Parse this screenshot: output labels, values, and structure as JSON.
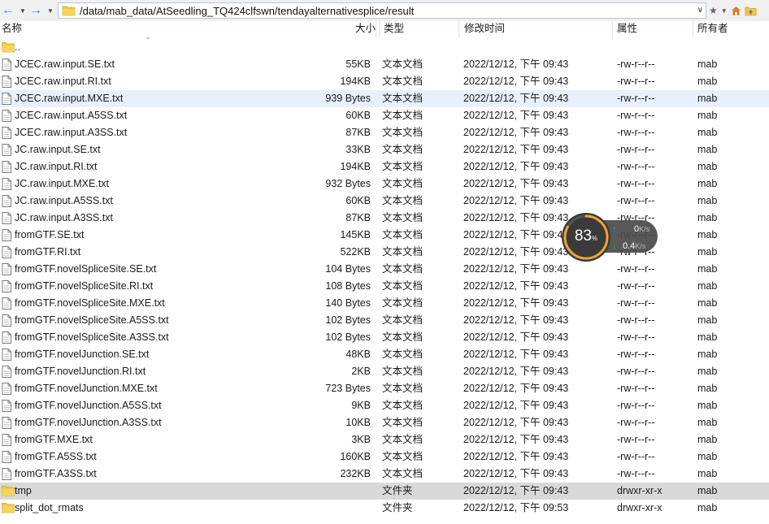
{
  "toolbar": {
    "path": "/data/mab_data/AtSeedling_TQ424clfswn/tendayalternativesplice/result",
    "back_icon": "back-arrow-icon",
    "forward_icon": "forward-arrow-icon",
    "star_icon": "star-icon",
    "home_icon": "home-icon",
    "parent_icon": "folder-up-icon"
  },
  "columns": {
    "name": "名称",
    "size": "大小",
    "type": "类型",
    "mtime": "修改时间",
    "perm": "属性",
    "owner": "所有者"
  },
  "rows": [
    {
      "name": "..",
      "size": "",
      "type": "",
      "mtime": "",
      "perm": "",
      "owner": "",
      "kind": "folder"
    },
    {
      "name": "JCEC.raw.input.SE.txt",
      "size": "55KB",
      "type": "文本文档",
      "mtime": "2022/12/12, 下午 09:43",
      "perm": "-rw-r--r--",
      "owner": "mab",
      "kind": "file"
    },
    {
      "name": "JCEC.raw.input.RI.txt",
      "size": "194KB",
      "type": "文本文档",
      "mtime": "2022/12/12, 下午 09:43",
      "perm": "-rw-r--r--",
      "owner": "mab",
      "kind": "file"
    },
    {
      "name": "JCEC.raw.input.MXE.txt",
      "size": "939 Bytes",
      "type": "文本文档",
      "mtime": "2022/12/12, 下午 09:43",
      "perm": "-rw-r--r--",
      "owner": "mab",
      "kind": "file"
    },
    {
      "name": "JCEC.raw.input.A5SS.txt",
      "size": "60KB",
      "type": "文本文档",
      "mtime": "2022/12/12, 下午 09:43",
      "perm": "-rw-r--r--",
      "owner": "mab",
      "kind": "file"
    },
    {
      "name": "JCEC.raw.input.A3SS.txt",
      "size": "87KB",
      "type": "文本文档",
      "mtime": "2022/12/12, 下午 09:43",
      "perm": "-rw-r--r--",
      "owner": "mab",
      "kind": "file"
    },
    {
      "name": "JC.raw.input.SE.txt",
      "size": "33KB",
      "type": "文本文档",
      "mtime": "2022/12/12, 下午 09:43",
      "perm": "-rw-r--r--",
      "owner": "mab",
      "kind": "file"
    },
    {
      "name": "JC.raw.input.RI.txt",
      "size": "194KB",
      "type": "文本文档",
      "mtime": "2022/12/12, 下午 09:43",
      "perm": "-rw-r--r--",
      "owner": "mab",
      "kind": "file"
    },
    {
      "name": "JC.raw.input.MXE.txt",
      "size": "932 Bytes",
      "type": "文本文档",
      "mtime": "2022/12/12, 下午 09:43",
      "perm": "-rw-r--r--",
      "owner": "mab",
      "kind": "file"
    },
    {
      "name": "JC.raw.input.A5SS.txt",
      "size": "60KB",
      "type": "文本文档",
      "mtime": "2022/12/12, 下午 09:43",
      "perm": "-rw-r--r--",
      "owner": "mab",
      "kind": "file"
    },
    {
      "name": "JC.raw.input.A3SS.txt",
      "size": "87KB",
      "type": "文本文档",
      "mtime": "2022/12/12, 下午 09:43",
      "perm": "-rw-r--r--",
      "owner": "mab",
      "kind": "file"
    },
    {
      "name": "fromGTF.SE.txt",
      "size": "145KB",
      "type": "文本文档",
      "mtime": "2022/12/12, 下午 09:43",
      "perm": "-rw-r--r--",
      "owner": "mab",
      "kind": "file"
    },
    {
      "name": "fromGTF.RI.txt",
      "size": "522KB",
      "type": "文本文档",
      "mtime": "2022/12/12, 下午 09:43",
      "perm": "-rw-r--r--",
      "owner": "mab",
      "kind": "file"
    },
    {
      "name": "fromGTF.novelSpliceSite.SE.txt",
      "size": "104 Bytes",
      "type": "文本文档",
      "mtime": "2022/12/12, 下午 09:43",
      "perm": "-rw-r--r--",
      "owner": "mab",
      "kind": "file"
    },
    {
      "name": "fromGTF.novelSpliceSite.RI.txt",
      "size": "108 Bytes",
      "type": "文本文档",
      "mtime": "2022/12/12, 下午 09:43",
      "perm": "-rw-r--r--",
      "owner": "mab",
      "kind": "file"
    },
    {
      "name": "fromGTF.novelSpliceSite.MXE.txt",
      "size": "140 Bytes",
      "type": "文本文档",
      "mtime": "2022/12/12, 下午 09:43",
      "perm": "-rw-r--r--",
      "owner": "mab",
      "kind": "file"
    },
    {
      "name": "fromGTF.novelSpliceSite.A5SS.txt",
      "size": "102 Bytes",
      "type": "文本文档",
      "mtime": "2022/12/12, 下午 09:43",
      "perm": "-rw-r--r--",
      "owner": "mab",
      "kind": "file"
    },
    {
      "name": "fromGTF.novelSpliceSite.A3SS.txt",
      "size": "102 Bytes",
      "type": "文本文档",
      "mtime": "2022/12/12, 下午 09:43",
      "perm": "-rw-r--r--",
      "owner": "mab",
      "kind": "file"
    },
    {
      "name": "fromGTF.novelJunction.SE.txt",
      "size": "48KB",
      "type": "文本文档",
      "mtime": "2022/12/12, 下午 09:43",
      "perm": "-rw-r--r--",
      "owner": "mab",
      "kind": "file"
    },
    {
      "name": "fromGTF.novelJunction.RI.txt",
      "size": "2KB",
      "type": "文本文档",
      "mtime": "2022/12/12, 下午 09:43",
      "perm": "-rw-r--r--",
      "owner": "mab",
      "kind": "file"
    },
    {
      "name": "fromGTF.novelJunction.MXE.txt",
      "size": "723 Bytes",
      "type": "文本文档",
      "mtime": "2022/12/12, 下午 09:43",
      "perm": "-rw-r--r--",
      "owner": "mab",
      "kind": "file"
    },
    {
      "name": "fromGTF.novelJunction.A5SS.txt",
      "size": "9KB",
      "type": "文本文档",
      "mtime": "2022/12/12, 下午 09:43",
      "perm": "-rw-r--r--",
      "owner": "mab",
      "kind": "file"
    },
    {
      "name": "fromGTF.novelJunction.A3SS.txt",
      "size": "10KB",
      "type": "文本文档",
      "mtime": "2022/12/12, 下午 09:43",
      "perm": "-rw-r--r--",
      "owner": "mab",
      "kind": "file"
    },
    {
      "name": "fromGTF.MXE.txt",
      "size": "3KB",
      "type": "文本文档",
      "mtime": "2022/12/12, 下午 09:43",
      "perm": "-rw-r--r--",
      "owner": "mab",
      "kind": "file"
    },
    {
      "name": "fromGTF.A5SS.txt",
      "size": "160KB",
      "type": "文本文档",
      "mtime": "2022/12/12, 下午 09:43",
      "perm": "-rw-r--r--",
      "owner": "mab",
      "kind": "file"
    },
    {
      "name": "fromGTF.A3SS.txt",
      "size": "232KB",
      "type": "文本文档",
      "mtime": "2022/12/12, 下午 09:43",
      "perm": "-rw-r--r--",
      "owner": "mab",
      "kind": "file"
    },
    {
      "name": "tmp",
      "size": "",
      "type": "文件夹",
      "mtime": "2022/12/12, 下午 09:43",
      "perm": "drwxr-xr-x",
      "owner": "mab",
      "kind": "folder"
    },
    {
      "name": "split_dot_rmats",
      "size": "",
      "type": "文件夹",
      "mtime": "2022/12/12, 下午 09:53",
      "perm": "drwxr-xr-x",
      "owner": "mab",
      "kind": "folder"
    }
  ],
  "highlight_row": 3,
  "selected_row": 26,
  "net_monitor": {
    "percent": "83",
    "percent_value": 0.83,
    "percent_sign": "%",
    "upload": "0",
    "upload_unit": "K/s",
    "download": "0.4",
    "download_unit": "K/s"
  },
  "colors": {
    "accent": "#3b7fd6",
    "folder": "#f5c542",
    "hover": "#e8f1fb",
    "selected": "#d9d9d9"
  }
}
